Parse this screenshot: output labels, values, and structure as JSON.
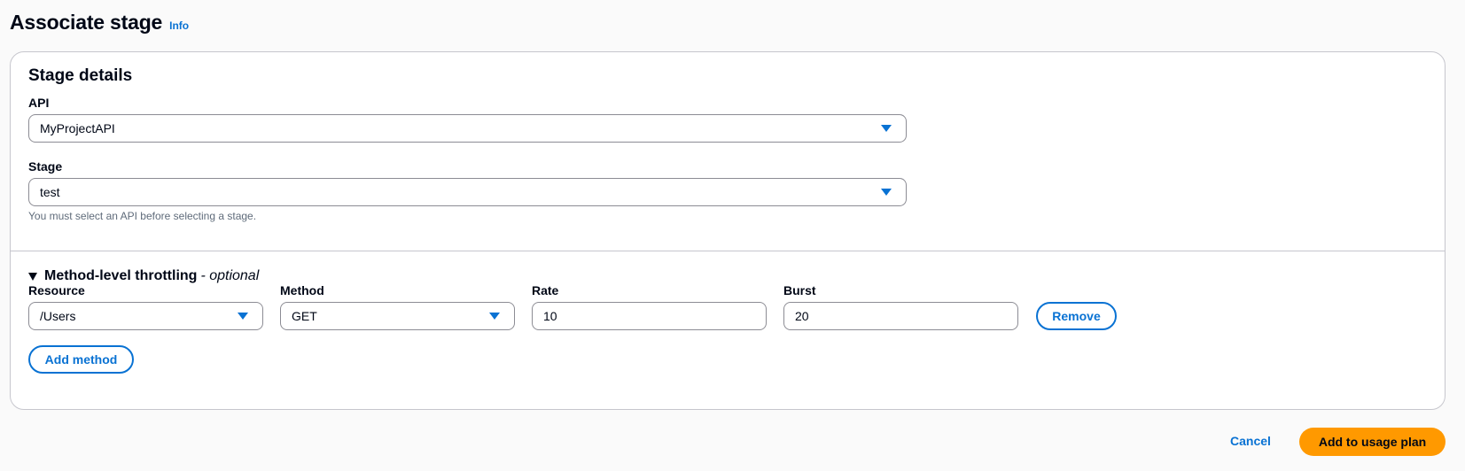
{
  "header": {
    "title": "Associate stage",
    "info_link": "Info"
  },
  "stage_details": {
    "title": "Stage details",
    "api": {
      "label": "API",
      "value": "MyProjectAPI"
    },
    "stage": {
      "label": "Stage",
      "value": "test",
      "hint": "You must select an API before selecting a stage."
    }
  },
  "throttling": {
    "title": "Method-level throttling",
    "optional": "- optional",
    "columns": {
      "resource": "Resource",
      "method": "Method",
      "rate": "Rate",
      "burst": "Burst"
    },
    "rows": [
      {
        "resource": "/Users",
        "method": "GET",
        "rate": "10",
        "burst": "20",
        "remove_label": "Remove"
      }
    ],
    "add_method_label": "Add method"
  },
  "footer": {
    "cancel_label": "Cancel",
    "submit_label": "Add to usage plan"
  },
  "colors": {
    "accent": "#0972d3",
    "primary": "#ff9900",
    "border": "#8c8c94",
    "divider": "#c6c6cd",
    "hint": "#5f6b7a"
  }
}
